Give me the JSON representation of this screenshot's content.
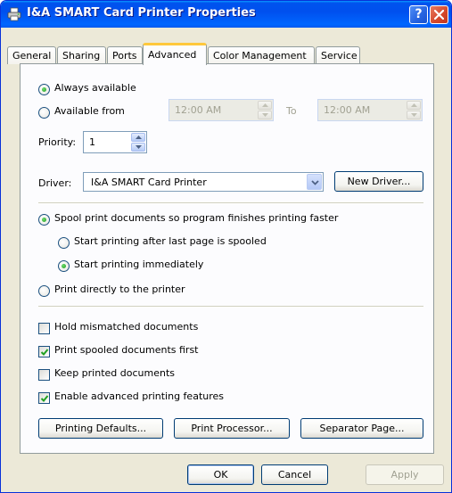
{
  "window": {
    "title": "I&A SMART Card Printer Properties"
  },
  "tabs": [
    {
      "label": "General"
    },
    {
      "label": "Sharing"
    },
    {
      "label": "Ports"
    },
    {
      "label": "Advanced"
    },
    {
      "label": "Color Management"
    },
    {
      "label": "Service"
    }
  ],
  "availability": {
    "always_label": "Always available",
    "from_label": "Available from",
    "from_time": "12:00 AM",
    "to_label": "To",
    "to_time": "12:00 AM"
  },
  "priority": {
    "label": "Priority:",
    "value": "1"
  },
  "driver": {
    "label": "Driver:",
    "value": "I&A SMART Card Printer",
    "new_button": "New Driver..."
  },
  "spool": {
    "spool_label": "Spool print documents so program finishes printing faster",
    "after_last_page": "Start printing after last page is spooled",
    "immediately": "Start printing immediately",
    "direct": "Print directly to the printer"
  },
  "options": {
    "hold_mismatched": "Hold mismatched documents",
    "spooled_first": "Print spooled documents first",
    "keep_printed": "Keep printed documents",
    "advanced_features": "Enable advanced printing features"
  },
  "bottom_buttons": {
    "defaults": "Printing Defaults...",
    "processor": "Print Processor...",
    "separator": "Separator Page..."
  },
  "dialog_buttons": {
    "ok": "OK",
    "cancel": "Cancel",
    "apply": "Apply"
  }
}
